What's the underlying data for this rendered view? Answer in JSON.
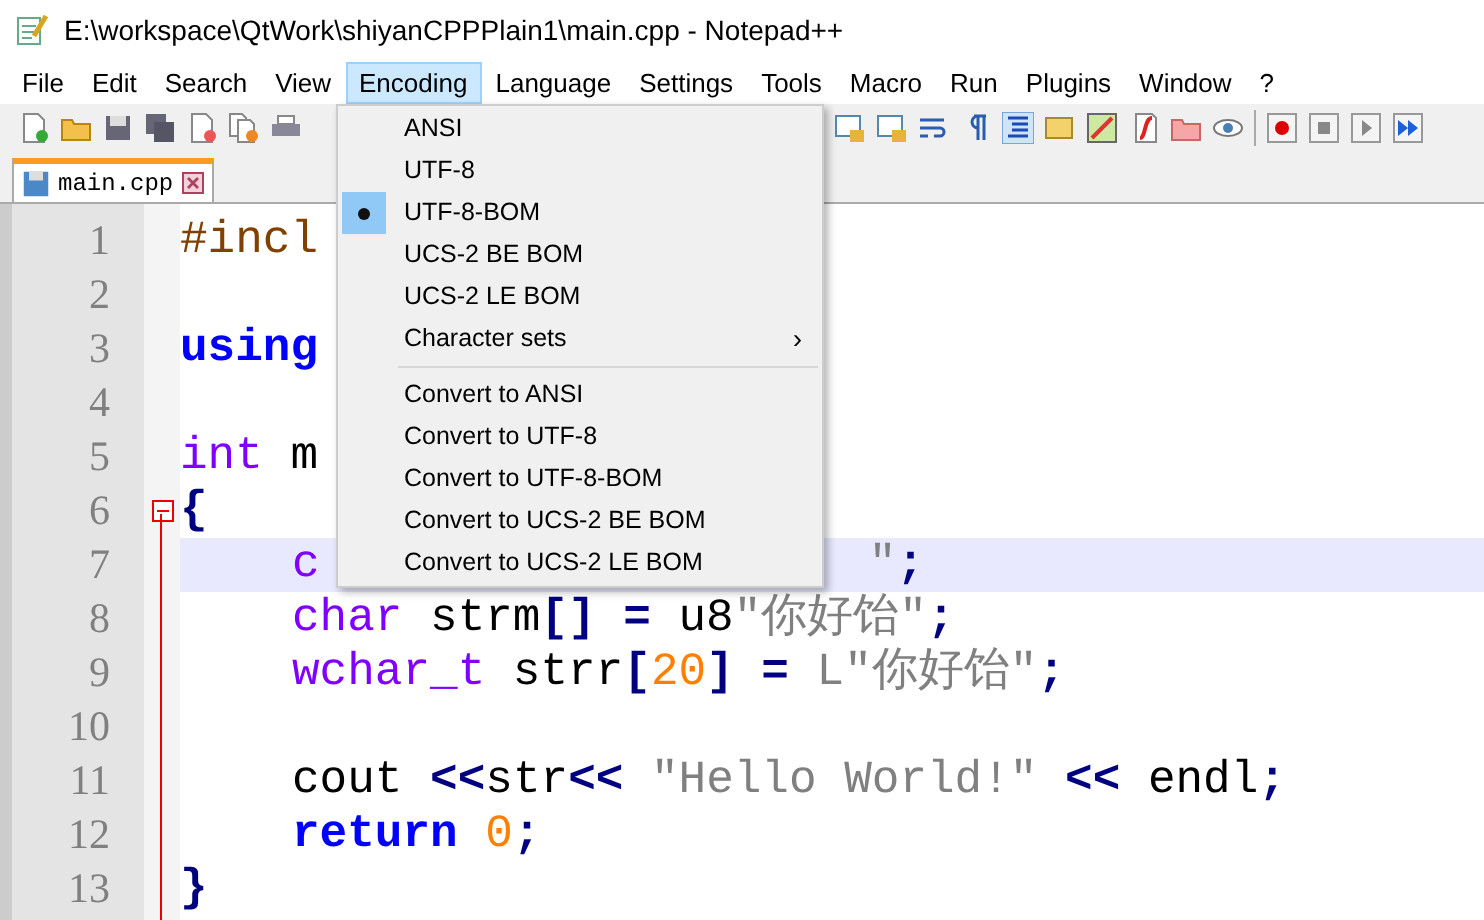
{
  "window": {
    "title": "E:\\workspace\\QtWork\\shiyanCPPPlain1\\main.cpp - Notepad++"
  },
  "menu_bar": [
    {
      "label": "File",
      "selected": false
    },
    {
      "label": "Edit",
      "selected": false
    },
    {
      "label": "Search",
      "selected": false
    },
    {
      "label": "View",
      "selected": false
    },
    {
      "label": "Encoding",
      "selected": true
    },
    {
      "label": "Language",
      "selected": false
    },
    {
      "label": "Settings",
      "selected": false
    },
    {
      "label": "Tools",
      "selected": false
    },
    {
      "label": "Macro",
      "selected": false
    },
    {
      "label": "Run",
      "selected": false
    },
    {
      "label": "Plugins",
      "selected": false
    },
    {
      "label": "Window",
      "selected": false
    },
    {
      "label": "?",
      "selected": false
    }
  ],
  "tabs": [
    {
      "label": "main.cpp",
      "selected": true
    }
  ],
  "dropdown": [
    {
      "kind": "item",
      "label": "ANSI",
      "checked": false
    },
    {
      "kind": "item",
      "label": "UTF-8",
      "checked": false
    },
    {
      "kind": "item",
      "label": "UTF-8-BOM",
      "checked": true
    },
    {
      "kind": "item",
      "label": "UCS-2 BE BOM",
      "checked": false
    },
    {
      "kind": "item",
      "label": "UCS-2 LE BOM",
      "checked": false
    },
    {
      "kind": "submenu",
      "label": "Character sets",
      "arrow": "›",
      "checked": false
    },
    {
      "kind": "separator"
    },
    {
      "kind": "item",
      "label": "Convert to ANSI",
      "checked": false
    },
    {
      "kind": "item",
      "label": "Convert to UTF-8",
      "checked": false
    },
    {
      "kind": "item",
      "label": "Convert to UTF-8-BOM",
      "checked": false
    },
    {
      "kind": "item",
      "label": "Convert to UCS-2 BE BOM",
      "checked": false
    },
    {
      "kind": "item",
      "label": "Convert to UCS-2 LE BOM",
      "checked": false
    }
  ],
  "editor": {
    "lines": [
      {
        "number": "1",
        "current": false,
        "fold": false,
        "indented": false,
        "tokens": [
          {
            "kind": "preprocessor",
            "text": "#incl"
          }
        ]
      },
      {
        "number": "2",
        "current": false,
        "fold": false
      },
      {
        "number": "3",
        "current": false,
        "fold": false,
        "indented": false,
        "tokens": [
          {
            "kind": "keyword",
            "text": "using"
          }
        ]
      },
      {
        "number": "4",
        "current": false,
        "fold": false
      },
      {
        "number": "5",
        "current": false,
        "fold": false,
        "indented": false,
        "tokens": [
          {
            "kind": "type",
            "text": "int"
          },
          {
            "kind": "plain",
            "text": " m"
          }
        ]
      },
      {
        "number": "6",
        "current": false,
        "fold": true,
        "indented": false,
        "tokens": [
          {
            "kind": "operator",
            "text": "{"
          }
        ]
      },
      {
        "number": "7",
        "current": true,
        "fold": false,
        "indented": true,
        "tokens": [
          {
            "kind": "type",
            "text": "c"
          }
        ],
        "after_menu": [
          {
            "kind": "string",
            "text": "\""
          },
          {
            "kind": "operator",
            "text": ";"
          }
        ]
      },
      {
        "number": "8",
        "current": false,
        "fold": false,
        "indented": true,
        "tokens": [
          {
            "kind": "type",
            "text": "char"
          },
          {
            "kind": "plain",
            "text": " strm"
          },
          {
            "kind": "operator",
            "text": "[]"
          },
          {
            "kind": "operator",
            "text": " ="
          },
          {
            "kind": "plain",
            "text": " u8"
          },
          {
            "kind": "string",
            "text": "\"你好饴\""
          },
          {
            "kind": "operator",
            "text": ";"
          }
        ]
      },
      {
        "number": "9",
        "current": false,
        "fold": false,
        "indented": true,
        "tokens": [
          {
            "kind": "type",
            "text": "wchar_t"
          },
          {
            "kind": "plain",
            "text": " strr"
          },
          {
            "kind": "operator",
            "text": "["
          },
          {
            "kind": "number",
            "text": "20"
          },
          {
            "kind": "operator",
            "text": "]"
          },
          {
            "kind": "operator",
            "text": " ="
          },
          {
            "kind": "string",
            "text": " L\"你好饴\""
          },
          {
            "kind": "operator",
            "text": ";"
          }
        ]
      },
      {
        "number": "10",
        "current": false,
        "fold": false
      },
      {
        "number": "11",
        "current": false,
        "fold": false,
        "indented": true,
        "tokens": [
          {
            "kind": "plain",
            "text": "cout"
          },
          {
            "kind": "operator",
            "text": " <<"
          },
          {
            "kind": "plain",
            "text": "str"
          },
          {
            "kind": "operator",
            "text": "<<"
          },
          {
            "kind": "string",
            "text": " \"Hello World!\""
          },
          {
            "kind": "operator",
            "text": " <<"
          },
          {
            "kind": "plain",
            "text": " endl"
          },
          {
            "kind": "operator",
            "text": ";"
          }
        ]
      },
      {
        "number": "12",
        "current": false,
        "fold": false,
        "indented": true,
        "tokens": [
          {
            "kind": "keyword",
            "text": "return"
          },
          {
            "kind": "number",
            "text": " 0"
          },
          {
            "kind": "operator",
            "text": ";"
          }
        ]
      },
      {
        "number": "13",
        "current": false,
        "fold": false,
        "indented": false,
        "tokens": [
          {
            "kind": "operator",
            "text": "}"
          }
        ]
      }
    ]
  }
}
